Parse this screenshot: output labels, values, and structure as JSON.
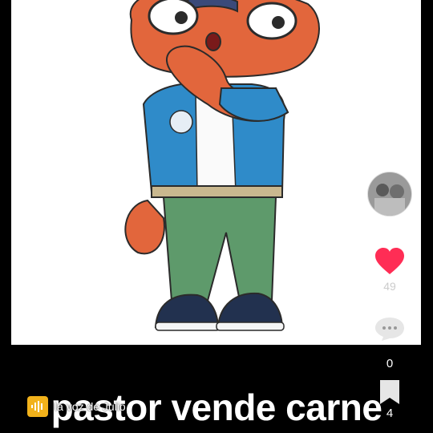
{
  "caption": {
    "text": "pastor vende carne"
  },
  "sound": {
    "label": "la voz de Julio",
    "icon": "sound-waveform-icon"
  },
  "sidebar": {
    "avatar_icon": "profile-avatar",
    "like": {
      "count": "49",
      "icon": "heart-icon",
      "color": "#ff2d55"
    },
    "comment": {
      "count": "0",
      "icon": "comment-bubble-icon"
    },
    "save": {
      "count": "4",
      "icon": "bookmark-icon"
    }
  },
  "colors": {
    "background": "#000000",
    "frame": "#ffffff",
    "sound_badge": "#f2b21b"
  }
}
